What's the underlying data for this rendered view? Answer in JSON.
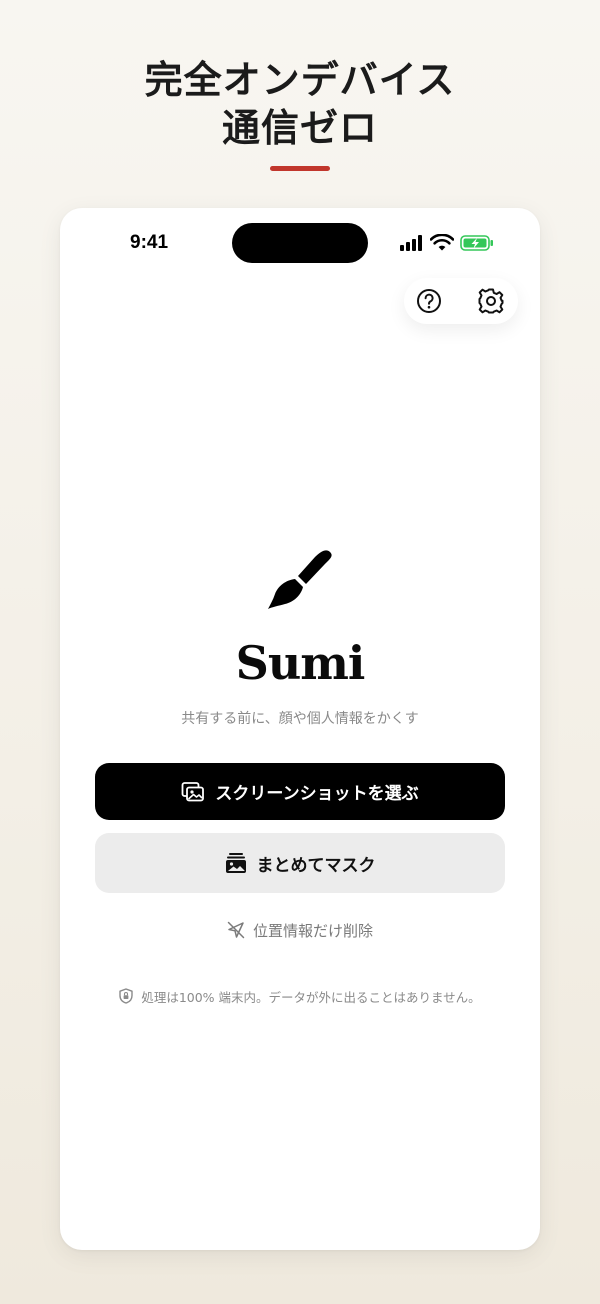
{
  "promo": {
    "headline_line1": "完全オンデバイス",
    "headline_line2": "通信ゼロ",
    "accent_color": "#c1362c"
  },
  "status_bar": {
    "time": "9:41",
    "battery_color": "#34c759"
  },
  "toolbar": {
    "help_icon": "question-circle-icon",
    "settings_icon": "gear-icon"
  },
  "app": {
    "logo_icon": "paintbrush-icon",
    "name": "Sumi",
    "tagline": "共有する前に、顔や個人情報をかくす"
  },
  "actions": {
    "primary_label": "スクリーンショットを選ぶ",
    "primary_icon": "photo-stack-icon",
    "secondary_label": "まとめてマスク",
    "secondary_icon": "photo-batch-icon",
    "link_label": "位置情報だけ削除",
    "link_icon": "location-slash-icon"
  },
  "footer": {
    "privacy_note": "処理は100% 端末内。データが外に出ることはありません。",
    "privacy_icon": "shield-lock-icon"
  }
}
